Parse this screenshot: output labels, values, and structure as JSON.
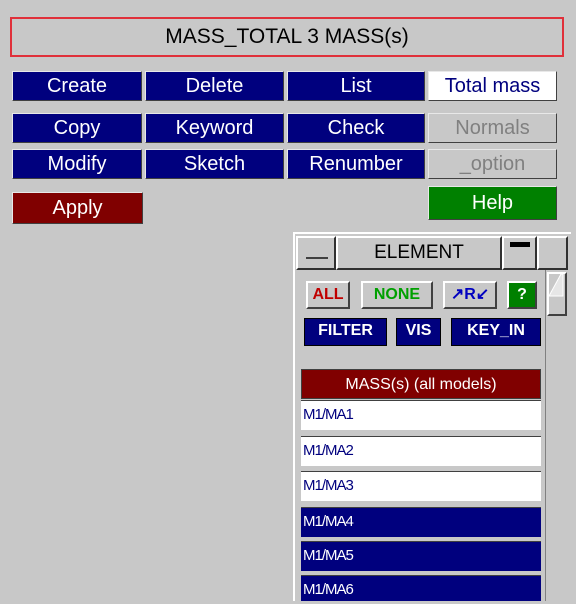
{
  "title": "MASS_TOTAL 3 MASS(s)",
  "buttons": {
    "create": "Create",
    "delete": "Delete",
    "list": "List",
    "total_mass": "Total mass",
    "copy": "Copy",
    "keyword": "Keyword",
    "check": "Check",
    "normals": "Normals",
    "modify": "Modify",
    "sketch": "Sketch",
    "renumber": "Renumber",
    "option": "_option",
    "apply": "Apply",
    "help": "Help"
  },
  "panel": {
    "title": "ELEMENT",
    "all": "ALL",
    "none": "NONE",
    "reverse": "R",
    "help": "?",
    "filter": "FILTER",
    "vis": "VIS",
    "key_in": "KEY_IN",
    "list_header": "MASS(s) (all models)",
    "items": [
      {
        "label": "M1/MA1",
        "selected": false
      },
      {
        "label": "M1/MA2",
        "selected": false
      },
      {
        "label": "M1/MA3",
        "selected": false
      },
      {
        "label": "M1/MA4",
        "selected": true
      },
      {
        "label": "M1/MA5",
        "selected": true
      },
      {
        "label": "M1/MA6",
        "selected": true
      }
    ]
  },
  "colors": {
    "navy": "#00007e",
    "maroon": "#800000",
    "green": "#008000",
    "background": "#c8c8c8",
    "title_border": "#e0303a"
  }
}
